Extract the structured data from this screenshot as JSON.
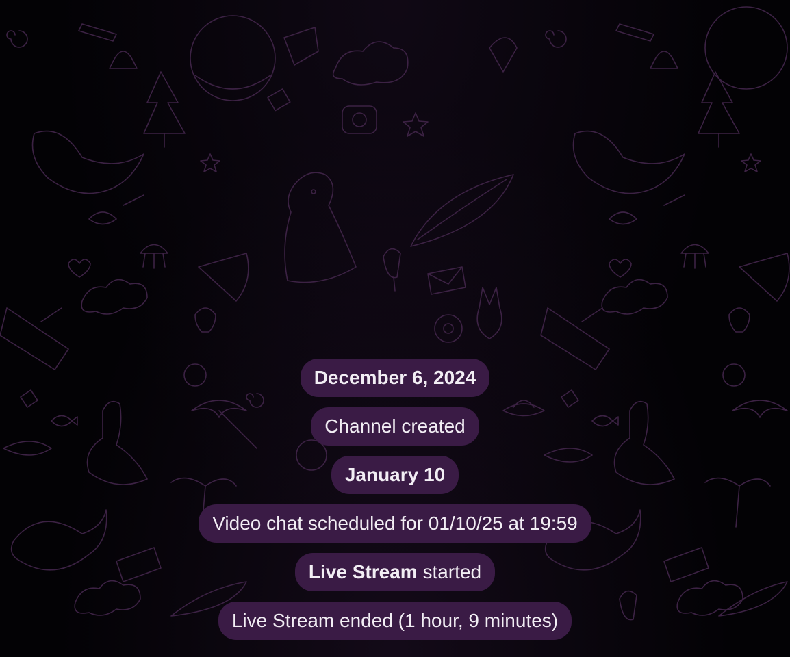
{
  "chat": {
    "messages": [
      {
        "kind": "date",
        "text": "December 6, 2024"
      },
      {
        "kind": "service",
        "text": "Channel created"
      },
      {
        "kind": "date",
        "text": "January 10"
      },
      {
        "kind": "service",
        "text": "Video chat scheduled for 01/10/25 at 19:59"
      },
      {
        "kind": "service",
        "bold": "Live Stream",
        "text": " started"
      },
      {
        "kind": "service",
        "text": "Live Stream ended (1 hour, 9 minutes)"
      }
    ]
  },
  "colors": {
    "background": "#030205",
    "bubble": "#3a1b45",
    "bubble_text": "#f2eef4",
    "doodle_stroke": "#3c2244"
  }
}
